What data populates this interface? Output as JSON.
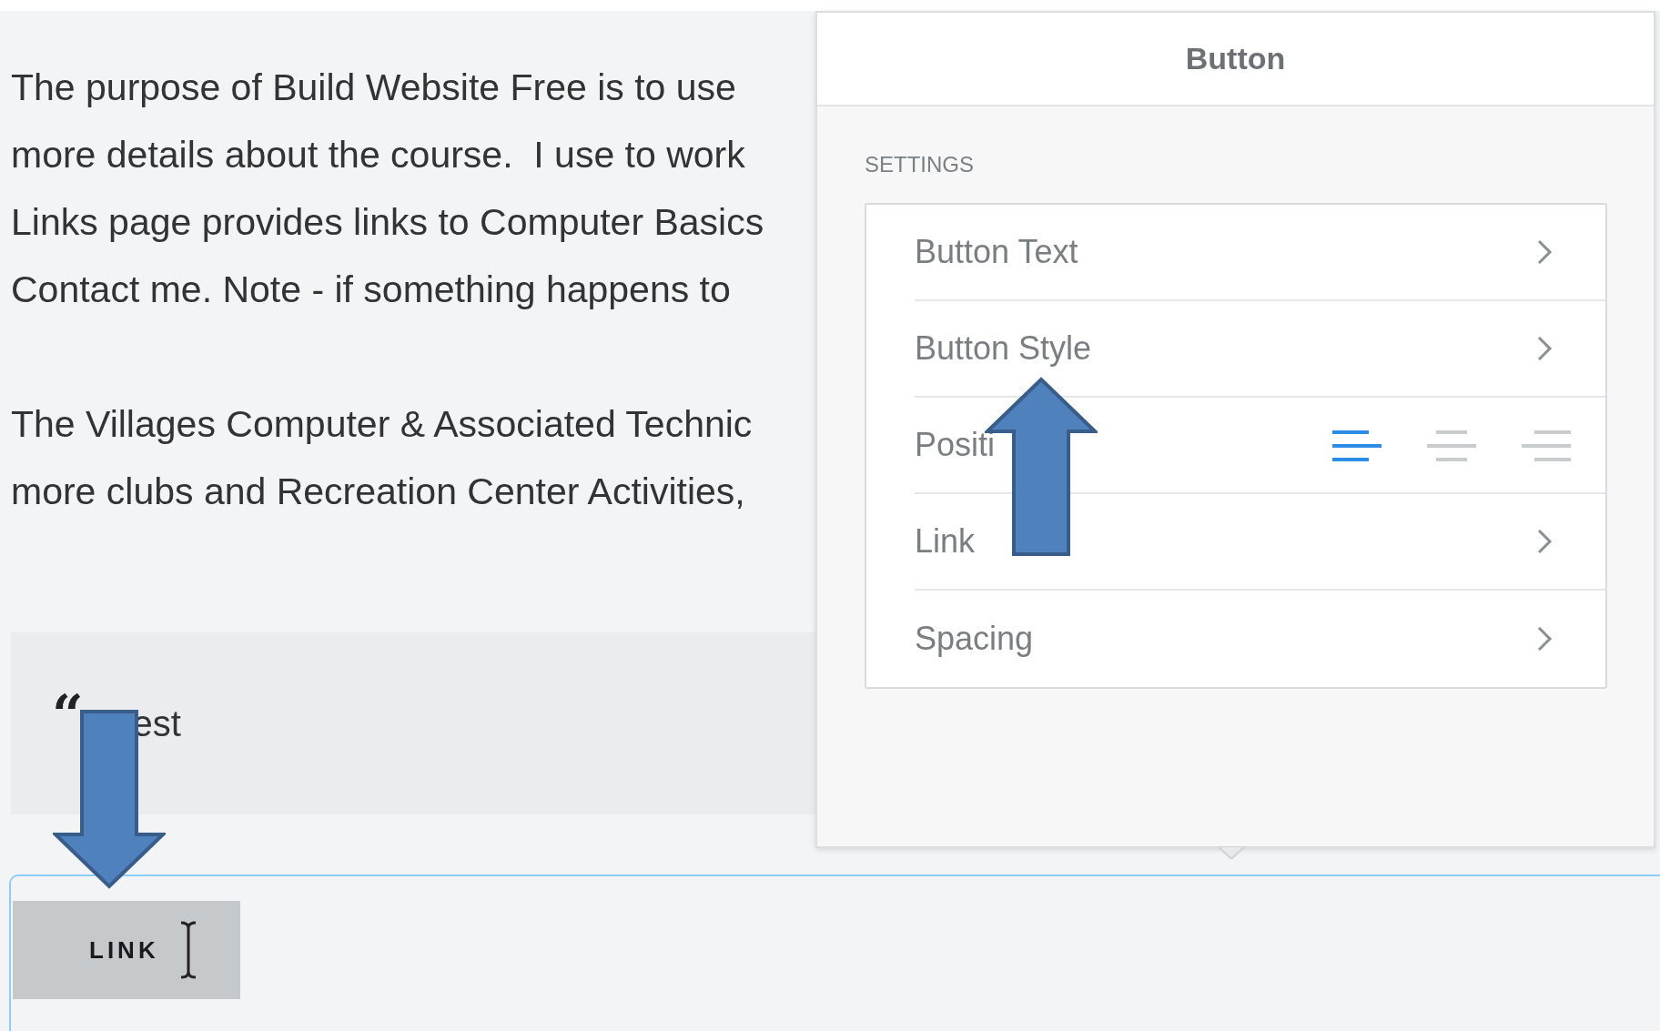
{
  "page": {
    "paragraphs": [
      [
        "The purpose of Build Website Free is to use",
        "more details about the course.  I use to work",
        "Links page provides links to Computer Basics",
        "Contact me. Note - if something happens to"
      ],
      [
        "The Villages Computer & Associated Technic",
        "more clubs and Recreation Center Activities,"
      ]
    ],
    "quote": {
      "mark": "“",
      "text": "est"
    },
    "button_block": {
      "selected": true,
      "label": "LINK"
    }
  },
  "panel": {
    "title": "Button",
    "section": "SETTINGS",
    "rows": [
      {
        "kind": "nav",
        "label": "Button Text"
      },
      {
        "kind": "nav",
        "label": "Button Style"
      },
      {
        "kind": "align",
        "label": "Positi",
        "options": [
          {
            "kind": "left",
            "selected": true
          },
          {
            "kind": "center",
            "selected": false
          },
          {
            "kind": "right",
            "selected": false
          }
        ]
      },
      {
        "kind": "nav",
        "label": "Link"
      },
      {
        "kind": "nav",
        "label": "Spacing"
      }
    ]
  }
}
